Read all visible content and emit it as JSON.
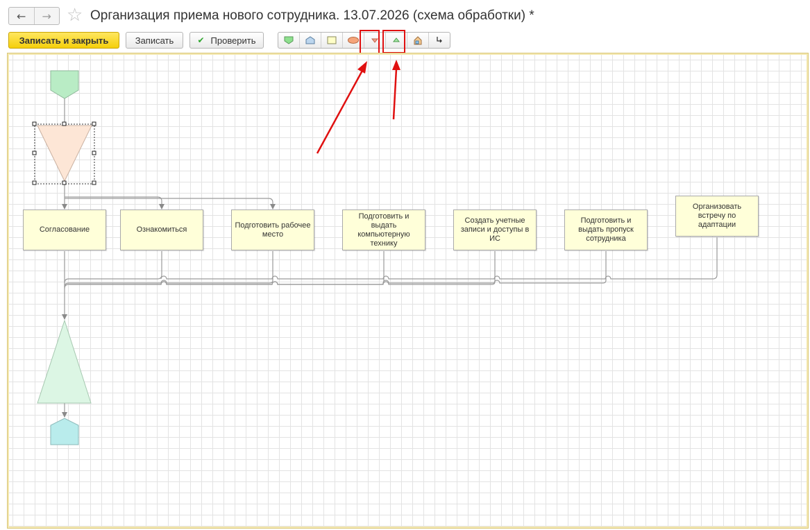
{
  "window": {
    "title": "Организация приема нового сотрудника. 13.07.2026 (схема обработки) *"
  },
  "nav": {
    "back_icon": "←",
    "forward_icon": "→",
    "star_icon": "☆"
  },
  "toolbar": {
    "save_close_label": "Записать и закрыть",
    "save_label": "Записать",
    "check_label": "Проверить",
    "check_icon": "✔",
    "shape_tools": [
      "start-point-icon",
      "end-point-icon",
      "action-icon",
      "activity-icon",
      "split-point-icon",
      "join-point-icon",
      "nested-process-icon",
      "connector-icon"
    ]
  },
  "diagram": {
    "tasks": [
      "Согласование",
      "Ознакомиться",
      "Подготовить рабочее место",
      "Подготовить и выдать компьютерную технику",
      "Создать учетные записи и доступы в ИС",
      "Подготовить и выдать пропуск сотрудника",
      "Организовать встречу по адаптации"
    ]
  },
  "colors": {
    "start": "#b9ecc5",
    "split": "#fde6d6",
    "join": "#dcf6e4",
    "end": "#b9ecec",
    "task_fill": "#ffffd9",
    "highlight": "#e01010",
    "primary_button": "#f5cf0a"
  }
}
